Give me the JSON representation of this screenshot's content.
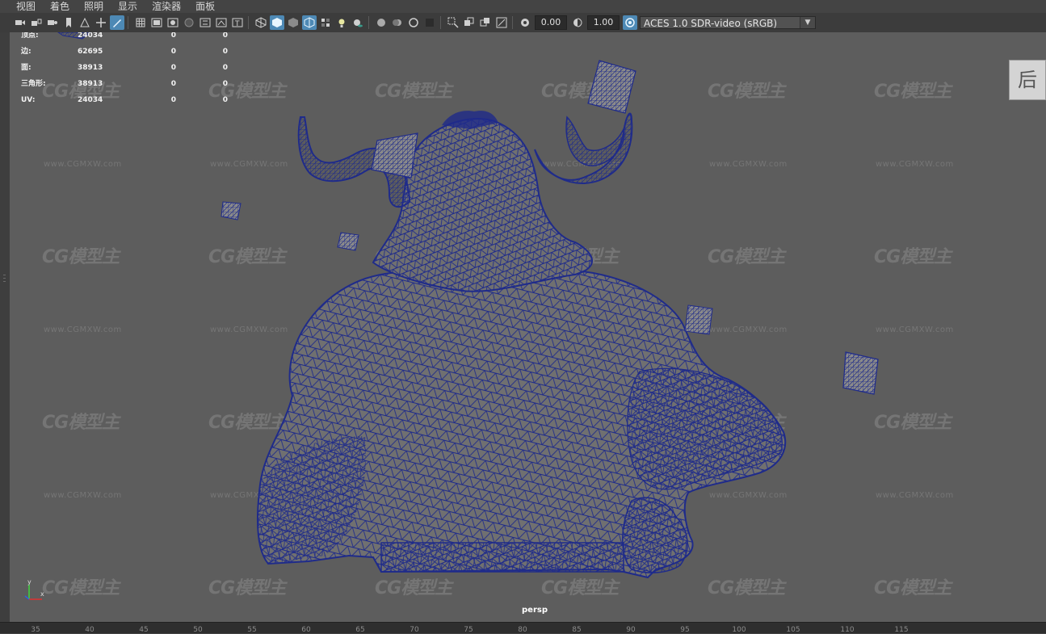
{
  "menu": [
    "视图",
    "着色",
    "照明",
    "显示",
    "渲染器",
    "面板"
  ],
  "toolbar": {
    "field1": "0.00",
    "field2": "1.00",
    "colorspace": "ACES 1.0 SDR-video (sRGB)"
  },
  "hud": {
    "rows": [
      {
        "label": "顶点:",
        "v1": "24034",
        "v2": "0",
        "v3": "0"
      },
      {
        "label": "边:",
        "v1": "62695",
        "v2": "0",
        "v3": "0"
      },
      {
        "label": "面:",
        "v1": "38913",
        "v2": "0",
        "v3": "0"
      },
      {
        "label": "三角形:",
        "v1": "38913",
        "v2": "0",
        "v3": "0"
      },
      {
        "label": "UV:",
        "v1": "24034",
        "v2": "0",
        "v3": "0"
      }
    ]
  },
  "viewport": {
    "camera": "persp",
    "view_cube_label": "后",
    "axis_y": "y",
    "axis_x": "x"
  },
  "watermark": {
    "logo": "CG模型主",
    "url": "www.CGMXW.com"
  },
  "timeline": {
    "ticks": [
      "35",
      "40",
      "45",
      "50",
      "55",
      "60",
      "65",
      "70",
      "75",
      "80",
      "85",
      "90",
      "95",
      "100",
      "105",
      "110",
      "115"
    ]
  },
  "colors": {
    "viewport_bg": "#5d5d5d",
    "wireframe": "#1f2b8a",
    "mesh_fill": "#707070",
    "accent": "#4d89b5"
  }
}
